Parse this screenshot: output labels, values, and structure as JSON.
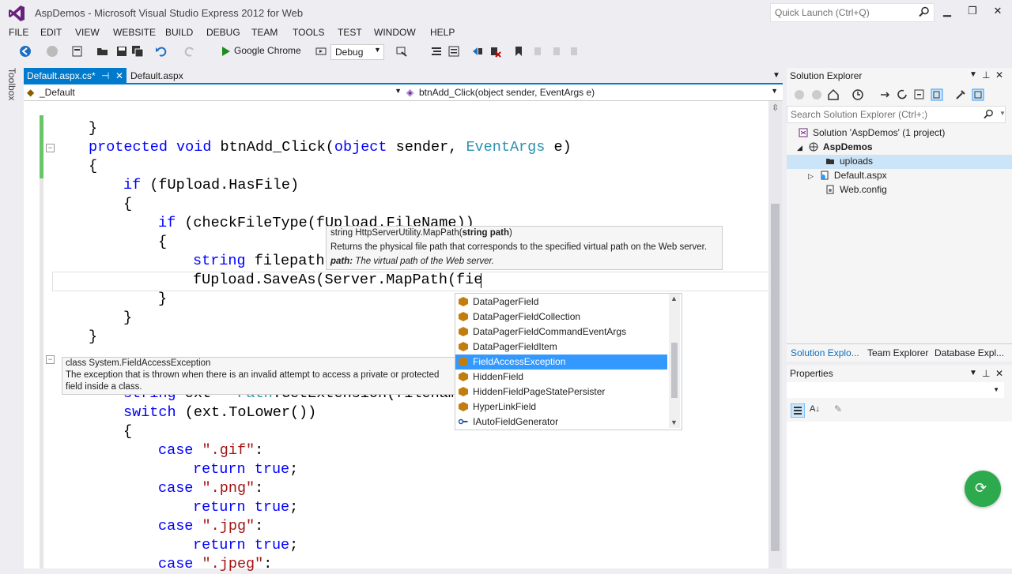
{
  "window": {
    "title": "AspDemos - Microsoft Visual Studio Express 2012 for Web",
    "quick_launch_placeholder": "Quick Launch (Ctrl+Q)"
  },
  "menu": [
    "FILE",
    "EDIT",
    "VIEW",
    "WEBSITE",
    "BUILD",
    "DEBUG",
    "TEAM",
    "TOOLS",
    "TEST",
    "WINDOW",
    "HELP"
  ],
  "toolbar": {
    "start_label": "Google Chrome",
    "configuration": "Debug"
  },
  "toolbox": {
    "label": "Toolbox"
  },
  "editor_tabs": [
    {
      "label": "Default.aspx.cs*",
      "active": true
    },
    {
      "label": "Default.aspx",
      "active": false
    }
  ],
  "navbar": {
    "type": "_Default",
    "member": "btnAdd_Click(object sender, EventArgs e)"
  },
  "code_lines": [
    "}",
    "protected void btnAdd_Click(object sender, EventArgs e)",
    "{",
    "if (fUpload.HasFile)",
    "{",
    "if (checkFileType(fUpload.FileName))",
    "{",
    "string filepath",
    "fUpload.SaveAs(Server.MapPath(fie",
    "}",
    "}",
    "}",
    "string ext = Path.GetExtension(filenam",
    "switch (ext.ToLower())",
    "{",
    "case \".gif\":",
    "return true;",
    "case \".png\":",
    "return true;",
    "case \".jpg\":",
    "return true;",
    "case \".jpeg\":"
  ],
  "signature_tip": {
    "signature_prefix": "string HttpServerUtility.MapPath(",
    "signature_param": "string path",
    "signature_suffix": ")",
    "description": "Returns the physical file path that corresponds to the specified virtual path on the Web server.",
    "param_name": "path:",
    "param_desc": " The virtual path of the Web server."
  },
  "class_tip": {
    "line1": "class System.FieldAccessException",
    "line2": "The exception that is thrown when there is an invalid attempt to access a private or protected",
    "line3": "field inside a class."
  },
  "completion": [
    "DataPagerField",
    "DataPagerFieldCollection",
    "DataPagerFieldCommandEventArgs",
    "DataPagerFieldItem",
    "FieldAccessException",
    "HiddenField",
    "HiddenFieldPageStatePersister",
    "HyperLinkField",
    "IAutoFieldGenerator"
  ],
  "completion_selected": 4,
  "solution_explorer": {
    "title": "Solution Explorer",
    "search_placeholder": "Search Solution Explorer (Ctrl+;)",
    "solution": "Solution 'AspDemos' (1 project)",
    "project": "AspDemos",
    "items": [
      "uploads",
      "Default.aspx",
      "Web.config"
    ],
    "tabs": [
      "Solution Explo...",
      "Team Explorer",
      "Database Expl..."
    ]
  },
  "properties": {
    "title": "Properties"
  },
  "colors": {
    "accent": "#007acc",
    "keyword": "#0000ff",
    "type": "#2b91af",
    "string": "#a31515",
    "selection": "#3399ff"
  }
}
